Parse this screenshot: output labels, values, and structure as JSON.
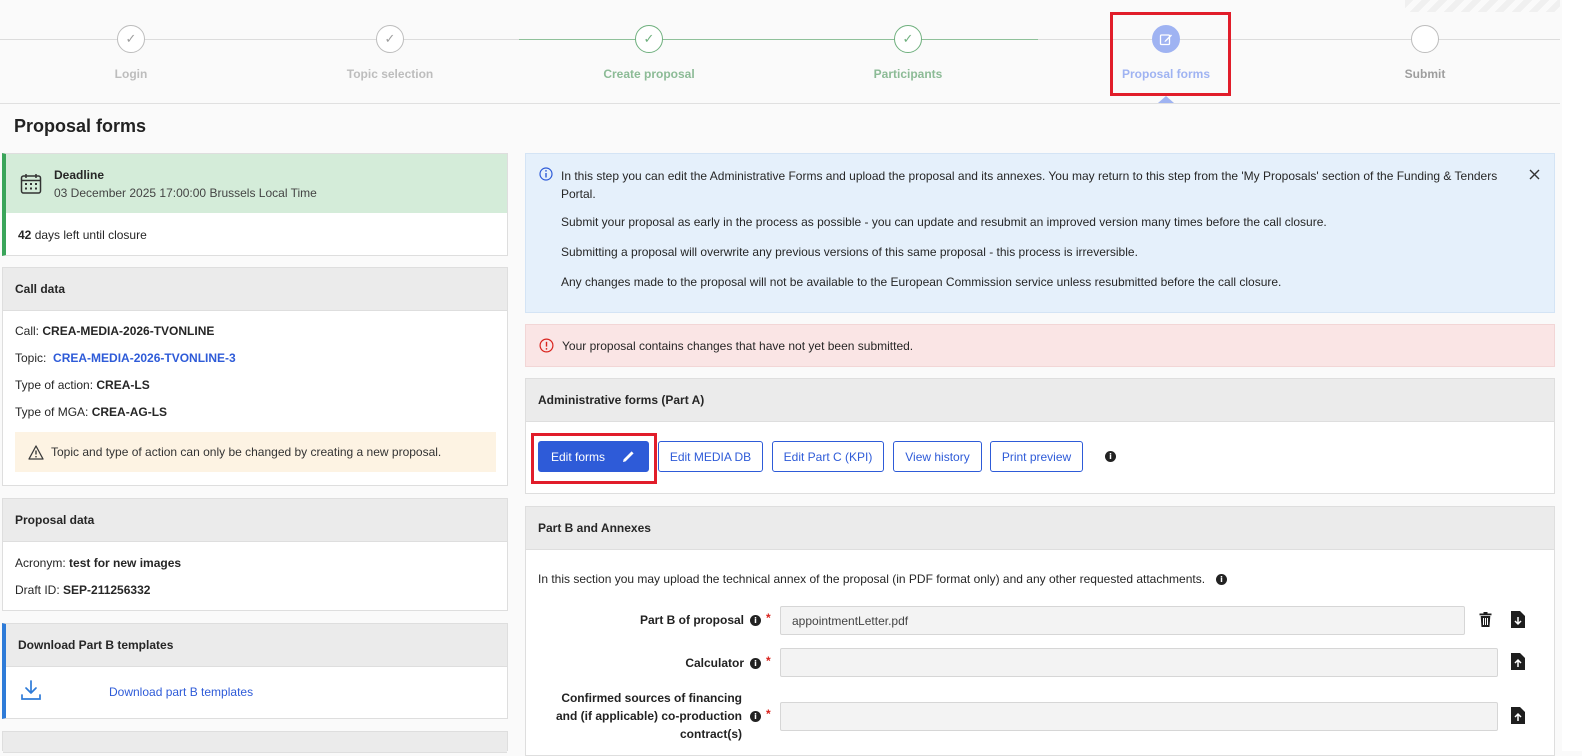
{
  "stepper": {
    "steps": [
      {
        "label": "Login",
        "state": "done-muted"
      },
      {
        "label": "Topic selection",
        "state": "done-muted"
      },
      {
        "label": "Create proposal",
        "state": "done"
      },
      {
        "label": "Participants",
        "state": "done"
      },
      {
        "label": "Proposal forms",
        "state": "active"
      },
      {
        "label": "Submit",
        "state": "pending"
      }
    ],
    "check_glyph": "✓"
  },
  "page_title": "Proposal forms",
  "deadline": {
    "label": "Deadline",
    "date": "03 December 2025 17:00:00 Brussels Local Time",
    "days_count": "42",
    "days_text": "days left until closure"
  },
  "call_data": {
    "header": "Call data",
    "call_label": "Call:",
    "call_value": "CREA-MEDIA-2026-TVONLINE",
    "topic_label": "Topic:",
    "topic_value": "CREA-MEDIA-2026-TVONLINE-3",
    "action_label": "Type of action:",
    "action_value": "CREA-LS",
    "mga_label": "Type of MGA:",
    "mga_value": "CREA-AG-LS",
    "warning": "Topic and type of action can only be changed by creating a new proposal."
  },
  "proposal_data": {
    "header": "Proposal data",
    "acronym_label": "Acronym:",
    "acronym_value": "test for new images",
    "draft_label": "Draft ID:",
    "draft_value": "SEP-211256332"
  },
  "templates": {
    "header": "Download Part B templates",
    "link": "Download part B templates"
  },
  "info_box": {
    "line1": "In this step you can edit the Administrative Forms and upload the proposal and its annexes. You may return to this step from the 'My Proposals' section of the Funding & Tenders",
    "line1b": "Portal.",
    "line2": "Submit your proposal as early in the process as possible - you can update and resubmit an improved version many times before the call closure.",
    "line3": "Submitting a proposal will overwrite any previous versions of this same proposal - this process is irreversible.",
    "line4": "Any changes made to the proposal will not be available to the European Commission service unless resubmitted before the call closure."
  },
  "alert": {
    "text": "Your proposal contains changes that have not yet been submitted."
  },
  "admin_forms": {
    "header": "Administrative forms (Part A)",
    "buttons": {
      "edit_forms": "Edit forms",
      "edit_media_db": "Edit MEDIA DB",
      "edit_part_c": "Edit Part C (KPI)",
      "view_history": "View history",
      "print_preview": "Print preview"
    }
  },
  "part_b": {
    "header": "Part B and Annexes",
    "intro": "In this section you may upload the technical annex of the proposal (in PDF format only) and any other requested attachments.",
    "fields": [
      {
        "label": "Part B of proposal",
        "value": "appointmentLetter.pdf"
      },
      {
        "label": "Calculator",
        "value": ""
      },
      {
        "label_lines": [
          "Confirmed sources of financing",
          "and (if applicable) co-production",
          "contract(s)"
        ],
        "value": ""
      }
    ]
  },
  "colors": {
    "primary": "#2e5bd8",
    "highlight_red": "#e11d2a",
    "deadline_bg": "#d4ecd9",
    "info_bg": "#e5f0fb",
    "alert_bg": "#fae5e5",
    "warning_bg": "#fdf3e3"
  }
}
